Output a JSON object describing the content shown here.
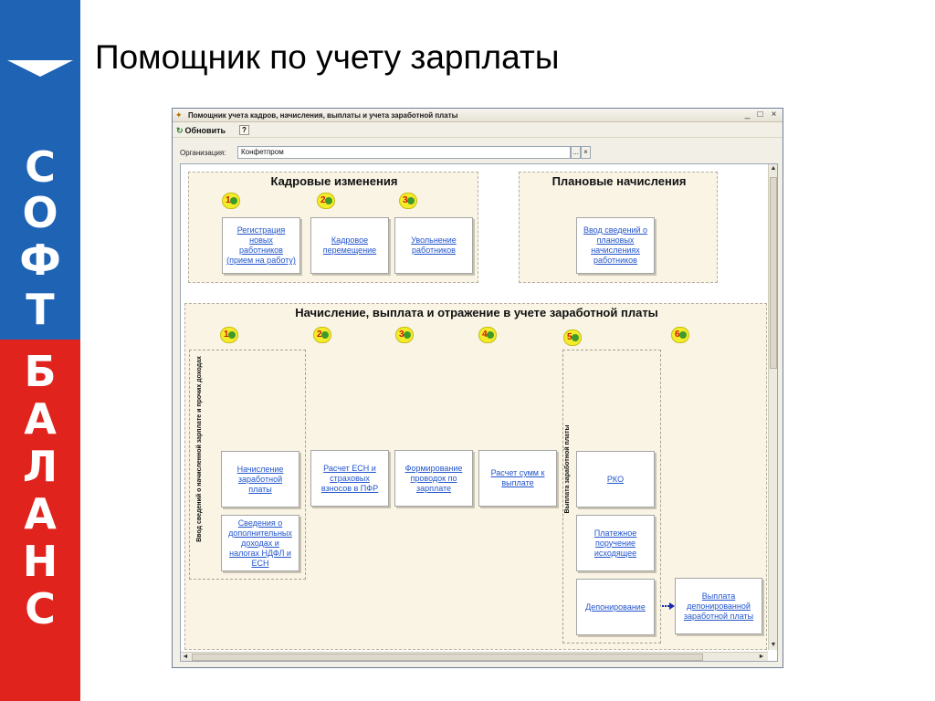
{
  "brand": {
    "letters_top": [
      "С",
      "О",
      "Ф",
      "Т"
    ],
    "letters_bottom": [
      "Б",
      "А",
      "Л",
      "А",
      "Н",
      "С"
    ],
    "colors": {
      "top": "#1f63b5",
      "bottom": "#e0231d"
    }
  },
  "slide_title": "Помощник по учету зарплаты",
  "window": {
    "title": "Помощник учета кадров, начисления, выплаты и учета заработной платы",
    "controls": {
      "minimize": "_",
      "maximize": "□",
      "close": "×"
    },
    "toolbar": {
      "refresh_label": "Обновить",
      "help_label": "?"
    },
    "org": {
      "label": "Организация:",
      "value": "Конфетпром",
      "select_button": "...",
      "clear_button": "×"
    }
  },
  "hr_changes": {
    "title": "Кадровые изменения",
    "steps": [
      "1",
      "2",
      "3"
    ],
    "items": [
      "Регистрация новых работников (прием на работу)",
      "Кадровое перемещение",
      "Увольнение работников"
    ]
  },
  "planned": {
    "title": "Плановые начисления",
    "items": [
      "Ввод сведений о плановых начислениях работников"
    ]
  },
  "payroll": {
    "title": "Начисление, выплата и отражение в учете заработной платы",
    "steps": [
      "1",
      "2",
      "3",
      "4",
      "5",
      "6"
    ],
    "input_group_label": "Ввод сведений о начисленной зарплате и прочих доходах",
    "payout_group_label": "Выплата заработной платы",
    "items": {
      "accrual": "Начисление заработной платы",
      "additional_income": "Сведения о дополнительных доходах и налогах НДФЛ и ЕСН",
      "esn_calc": "Расчет ЕСН и страховых взносов в ПФР",
      "postings": "Формирование проводок по зарплате",
      "payout_calc": "Расчет сумм к выплате",
      "rko": "РКО",
      "payment_order": "Платежное поручение исходящее",
      "deposit": "Депонирование",
      "deposit_payout": "Выплата депонированной заработной платы"
    }
  },
  "scrollbars": {
    "up": "▲",
    "down": "▼",
    "left": "◄",
    "right": "►"
  }
}
